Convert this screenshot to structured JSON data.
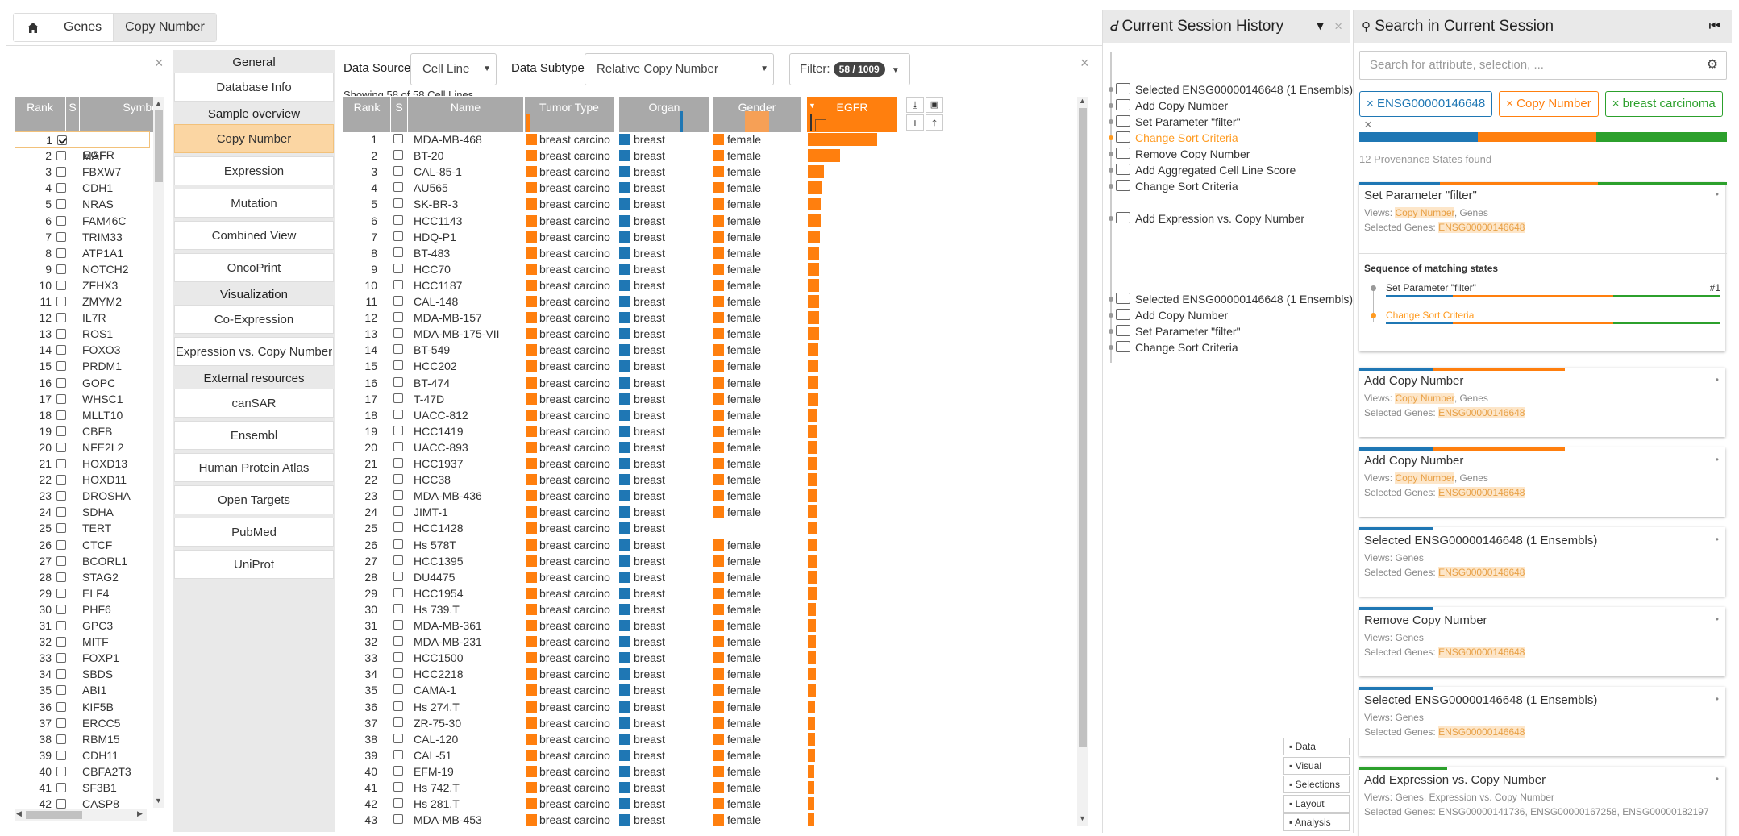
{
  "breadcrumb": {
    "home_icon": "home-icon",
    "items": [
      "Genes",
      "Copy Number"
    ]
  },
  "genes_table": {
    "headers": {
      "rank": "Rank",
      "sel": "S",
      "symbol": "Symbol"
    },
    "rows": [
      {
        "rank": "1",
        "symbol": "EGFR",
        "checked": true
      },
      {
        "rank": "2",
        "symbol": "MAF"
      },
      {
        "rank": "3",
        "symbol": "FBXW7"
      },
      {
        "rank": "4",
        "symbol": "CDH1"
      },
      {
        "rank": "5",
        "symbol": "NRAS"
      },
      {
        "rank": "6",
        "symbol": "FAM46C"
      },
      {
        "rank": "7",
        "symbol": "TRIM33"
      },
      {
        "rank": "8",
        "symbol": "ATP1A1"
      },
      {
        "rank": "9",
        "symbol": "NOTCH2"
      },
      {
        "rank": "10",
        "symbol": "ZFHX3"
      },
      {
        "rank": "11",
        "symbol": "ZMYM2"
      },
      {
        "rank": "12",
        "symbol": "IL7R"
      },
      {
        "rank": "13",
        "symbol": "ROS1"
      },
      {
        "rank": "14",
        "symbol": "FOXO3"
      },
      {
        "rank": "15",
        "symbol": "PRDM1"
      },
      {
        "rank": "16",
        "symbol": "GOPC"
      },
      {
        "rank": "17",
        "symbol": "WHSC1"
      },
      {
        "rank": "18",
        "symbol": "MLLT10"
      },
      {
        "rank": "19",
        "symbol": "CBFB"
      },
      {
        "rank": "20",
        "symbol": "NFE2L2"
      },
      {
        "rank": "21",
        "symbol": "HOXD13"
      },
      {
        "rank": "22",
        "symbol": "HOXD11"
      },
      {
        "rank": "23",
        "symbol": "DROSHA"
      },
      {
        "rank": "24",
        "symbol": "SDHA"
      },
      {
        "rank": "25",
        "symbol": "TERT"
      },
      {
        "rank": "26",
        "symbol": "CTCF"
      },
      {
        "rank": "27",
        "symbol": "BCORL1"
      },
      {
        "rank": "28",
        "symbol": "STAG2"
      },
      {
        "rank": "29",
        "symbol": "ELF4"
      },
      {
        "rank": "30",
        "symbol": "PHF6"
      },
      {
        "rank": "31",
        "symbol": "GPC3"
      },
      {
        "rank": "32",
        "symbol": "MITF"
      },
      {
        "rank": "33",
        "symbol": "FOXP1"
      },
      {
        "rank": "34",
        "symbol": "SBDS"
      },
      {
        "rank": "35",
        "symbol": "ABI1"
      },
      {
        "rank": "36",
        "symbol": "KIF5B"
      },
      {
        "rank": "37",
        "symbol": "ERCC5"
      },
      {
        "rank": "38",
        "symbol": "RBM15"
      },
      {
        "rank": "39",
        "symbol": "CDH11"
      },
      {
        "rank": "40",
        "symbol": "CBFA2T3"
      },
      {
        "rank": "41",
        "symbol": "SF3B1"
      },
      {
        "rank": "42",
        "symbol": "CASP8"
      }
    ]
  },
  "nav": {
    "sections": [
      {
        "title": "General",
        "items": [
          "Database Info"
        ]
      },
      {
        "title": "Sample overview",
        "items": [
          "Copy Number",
          "Expression",
          "Mutation",
          "Combined View",
          "OncoPrint"
        ]
      },
      {
        "title": "Visualization",
        "items": [
          "Co-Expression",
          "Expression vs. Copy Number"
        ]
      },
      {
        "title": "External resources",
        "items": [
          "canSAR",
          "Ensembl",
          "Human Protein Atlas",
          "Open Targets",
          "PubMed",
          "UniProt"
        ]
      }
    ],
    "active": "Copy Number"
  },
  "controls": {
    "data_source_label": "Data Source",
    "data_source_value": "Cell Line",
    "data_subtype_label": "Data Subtype",
    "data_subtype_value": "Relative Copy Number",
    "filter_label": "Filter:",
    "filter_count": "58 / 1009",
    "showing_text": "Showing 58 of 58 Cell Lines"
  },
  "cell_table": {
    "headers": {
      "rank": "Rank",
      "sel": "S",
      "name": "Name",
      "tumor": "Tumor Type",
      "organ": "Organ",
      "gender": "Gender",
      "egfr": "EGFR"
    },
    "colors": {
      "orange": "#ff7f0e",
      "blue": "#1f77b4"
    },
    "rows": [
      {
        "rank": "1",
        "name": "MDA-MB-468",
        "tumor": "breast carcino",
        "organ": "breast",
        "gender": "female",
        "egfr": 0.95
      },
      {
        "rank": "2",
        "name": "BT-20",
        "tumor": "breast carcino",
        "organ": "breast",
        "gender": "female",
        "egfr": 0.44
      },
      {
        "rank": "3",
        "name": "CAL-85-1",
        "tumor": "breast carcino",
        "organ": "breast",
        "gender": "female",
        "egfr": 0.22
      },
      {
        "rank": "4",
        "name": "AU565",
        "tumor": "breast carcino",
        "organ": "breast",
        "gender": "female",
        "egfr": 0.19
      },
      {
        "rank": "5",
        "name": "SK-BR-3",
        "tumor": "breast carcino",
        "organ": "breast",
        "gender": "female",
        "egfr": 0.18
      },
      {
        "rank": "6",
        "name": "HCC1143",
        "tumor": "breast carcino",
        "organ": "breast",
        "gender": "female",
        "egfr": 0.18
      },
      {
        "rank": "7",
        "name": "HDQ-P1",
        "tumor": "breast carcino",
        "organ": "breast",
        "gender": "female",
        "egfr": 0.17
      },
      {
        "rank": "8",
        "name": "BT-483",
        "tumor": "breast carcino",
        "organ": "breast",
        "gender": "female",
        "egfr": 0.16
      },
      {
        "rank": "9",
        "name": "HCC70",
        "tumor": "breast carcino",
        "organ": "breast",
        "gender": "female",
        "egfr": 0.16
      },
      {
        "rank": "10",
        "name": "HCC1187",
        "tumor": "breast carcino",
        "organ": "breast",
        "gender": "female",
        "egfr": 0.16
      },
      {
        "rank": "11",
        "name": "CAL-148",
        "tumor": "breast carcino",
        "organ": "breast",
        "gender": "female",
        "egfr": 0.15
      },
      {
        "rank": "12",
        "name": "MDA-MB-157",
        "tumor": "breast carcino",
        "organ": "breast",
        "gender": "female",
        "egfr": 0.15
      },
      {
        "rank": "13",
        "name": "MDA-MB-175-VII",
        "tumor": "breast carcino",
        "organ": "breast",
        "gender": "female",
        "egfr": 0.15
      },
      {
        "rank": "14",
        "name": "BT-549",
        "tumor": "breast carcino",
        "organ": "breast",
        "gender": "female",
        "egfr": 0.14
      },
      {
        "rank": "15",
        "name": "HCC202",
        "tumor": "breast carcino",
        "organ": "breast",
        "gender": "female",
        "egfr": 0.14
      },
      {
        "rank": "16",
        "name": "BT-474",
        "tumor": "breast carcino",
        "organ": "breast",
        "gender": "female",
        "egfr": 0.14
      },
      {
        "rank": "17",
        "name": "T-47D",
        "tumor": "breast carcino",
        "organ": "breast",
        "gender": "female",
        "egfr": 0.14
      },
      {
        "rank": "18",
        "name": "UACC-812",
        "tumor": "breast carcino",
        "organ": "breast",
        "gender": "female",
        "egfr": 0.13
      },
      {
        "rank": "19",
        "name": "HCC1419",
        "tumor": "breast carcino",
        "organ": "breast",
        "gender": "female",
        "egfr": 0.13
      },
      {
        "rank": "20",
        "name": "UACC-893",
        "tumor": "breast carcino",
        "organ": "breast",
        "gender": "female",
        "egfr": 0.13
      },
      {
        "rank": "21",
        "name": "HCC1937",
        "tumor": "breast carcino",
        "organ": "breast",
        "gender": "female",
        "egfr": 0.13
      },
      {
        "rank": "22",
        "name": "HCC38",
        "tumor": "breast carcino",
        "organ": "breast",
        "gender": "female",
        "egfr": 0.13
      },
      {
        "rank": "23",
        "name": "MDA-MB-436",
        "tumor": "breast carcino",
        "organ": "breast",
        "gender": "female",
        "egfr": 0.13
      },
      {
        "rank": "24",
        "name": "JIMT-1",
        "tumor": "breast carcino",
        "organ": "breast",
        "gender": "female",
        "egfr": 0.12
      },
      {
        "rank": "25",
        "name": "HCC1428",
        "tumor": "breast carcino",
        "organ": "breast",
        "gender": "",
        "egfr": 0.12
      },
      {
        "rank": "26",
        "name": "Hs 578T",
        "tumor": "breast carcino",
        "organ": "breast",
        "gender": "female",
        "egfr": 0.12
      },
      {
        "rank": "27",
        "name": "HCC1395",
        "tumor": "breast carcino",
        "organ": "breast",
        "gender": "female",
        "egfr": 0.12
      },
      {
        "rank": "28",
        "name": "DU4475",
        "tumor": "breast carcino",
        "organ": "breast",
        "gender": "female",
        "egfr": 0.12
      },
      {
        "rank": "29",
        "name": "HCC1954",
        "tumor": "breast carcino",
        "organ": "breast",
        "gender": "female",
        "egfr": 0.12
      },
      {
        "rank": "30",
        "name": "Hs 739.T",
        "tumor": "breast carcino",
        "organ": "breast",
        "gender": "female",
        "egfr": 0.11
      },
      {
        "rank": "31",
        "name": "MDA-MB-361",
        "tumor": "breast carcino",
        "organ": "breast",
        "gender": "female",
        "egfr": 0.11
      },
      {
        "rank": "32",
        "name": "MDA-MB-231",
        "tumor": "breast carcino",
        "organ": "breast",
        "gender": "female",
        "egfr": 0.11
      },
      {
        "rank": "33",
        "name": "HCC1500",
        "tumor": "breast carcino",
        "organ": "breast",
        "gender": "female",
        "egfr": 0.11
      },
      {
        "rank": "34",
        "name": "HCC2218",
        "tumor": "breast carcino",
        "organ": "breast",
        "gender": "female",
        "egfr": 0.11
      },
      {
        "rank": "35",
        "name": "CAMA-1",
        "tumor": "breast carcino",
        "organ": "breast",
        "gender": "female",
        "egfr": 0.11
      },
      {
        "rank": "36",
        "name": "Hs 274.T",
        "tumor": "breast carcino",
        "organ": "breast",
        "gender": "female",
        "egfr": 0.1
      },
      {
        "rank": "37",
        "name": "ZR-75-30",
        "tumor": "breast carcino",
        "organ": "breast",
        "gender": "female",
        "egfr": 0.1
      },
      {
        "rank": "38",
        "name": "CAL-120",
        "tumor": "breast carcino",
        "organ": "breast",
        "gender": "female",
        "egfr": 0.1
      },
      {
        "rank": "39",
        "name": "CAL-51",
        "tumor": "breast carcino",
        "organ": "breast",
        "gender": "female",
        "egfr": 0.1
      },
      {
        "rank": "40",
        "name": "EFM-19",
        "tumor": "breast carcino",
        "organ": "breast",
        "gender": "female",
        "egfr": 0.09
      },
      {
        "rank": "41",
        "name": "Hs 742.T",
        "tumor": "breast carcino",
        "organ": "breast",
        "gender": "female",
        "egfr": 0.09
      },
      {
        "rank": "42",
        "name": "Hs 281.T",
        "tumor": "breast carcino",
        "organ": "breast",
        "gender": "female",
        "egfr": 0.09
      },
      {
        "rank": "43",
        "name": "MDA-MB-453",
        "tumor": "breast carcino",
        "organ": "breast",
        "gender": "female",
        "egfr": 0.09
      }
    ]
  },
  "history": {
    "title": "Current Session History",
    "items": [
      {
        "text": "Selected ENSG00000146648 (1 Ensembls)",
        "icon": "selection-icon"
      },
      {
        "text": "Add Copy Number",
        "icon": "chart-add-icon"
      },
      {
        "text": "Set Parameter \"filter\"",
        "icon": "chart-param-icon"
      },
      {
        "text": "Change Sort Criteria",
        "icon": "monitor-icon",
        "active": true
      },
      {
        "text": "Remove Copy Number",
        "icon": "chart-remove-icon"
      },
      {
        "text": "Add Aggregated Cell Line Score",
        "icon": "db-add-icon"
      },
      {
        "text": "Change Sort Criteria",
        "icon": "monitor-icon"
      },
      {
        "text": "",
        "icon": ""
      },
      {
        "text": "Add Expression vs. Copy Number",
        "icon": "chart-add-icon"
      },
      {
        "text": "",
        "icon": ""
      },
      {
        "text": "",
        "icon": ""
      },
      {
        "text": "",
        "icon": ""
      },
      {
        "text": "",
        "icon": ""
      },
      {
        "text": "Selected ENSG00000146648 (1 Ensembls)",
        "icon": "selection-icon"
      },
      {
        "text": "Add Copy Number",
        "icon": "chart-add-icon"
      },
      {
        "text": "Set Parameter \"filter\"",
        "icon": "chart-param-icon"
      },
      {
        "text": "Change Sort Criteria",
        "icon": "monitor-icon"
      }
    ],
    "side_buttons": [
      "Data",
      "Visual",
      "Selections",
      "Layout",
      "Analysis"
    ]
  },
  "search": {
    "title": "Search in Current Session",
    "placeholder": "Search for attribute, selection, ...",
    "tags": [
      {
        "label": "ENSG00000146648",
        "color": "#1f77b4"
      },
      {
        "label": "Copy Number",
        "color": "#ff7f0e"
      },
      {
        "label": "breast carcinoma",
        "color": "#2ca02c"
      }
    ],
    "found_text": "12 Provenance States found",
    "views_label": "Views:",
    "genes_label": "Selected Genes:",
    "cards": [
      {
        "title": "Set Parameter \"filter\"",
        "views_hl": "Copy Number",
        "views_rest": ", Genes",
        "genes": "ENSG00000146648",
        "expanded": true,
        "seq_title": "Sequence of matching states",
        "seq_items": [
          {
            "label": "Set Parameter \"filter\"",
            "num": "#1"
          },
          {
            "label": "Change Sort Criteria"
          }
        ]
      },
      {
        "title": "Add Copy Number",
        "views_hl": "Copy Number",
        "views_rest": ", Genes",
        "genes": "ENSG00000146648"
      },
      {
        "title": "Add Copy Number",
        "views_hl": "Copy Number",
        "views_rest": ", Genes",
        "genes": "ENSG00000146648"
      },
      {
        "title": "Selected ENSG00000146648 (1 Ensembls)",
        "views_hl": "",
        "views_rest": "Genes",
        "genes": "ENSG00000146648"
      },
      {
        "title": "Remove Copy Number",
        "views_hl": "",
        "views_rest": "Genes",
        "genes": "ENSG00000146648"
      },
      {
        "title": "Selected ENSG00000146648 (1 Ensembls)",
        "views_hl": "",
        "views_rest": "Genes",
        "genes": "ENSG00000146648"
      },
      {
        "title": "Add Expression vs. Copy Number",
        "views_hl": "",
        "views_rest": "Genes, Expression vs. Copy Number",
        "genes_plain": "ENSG00000141736, ENSG00000167258, ENSG00000182197"
      }
    ]
  }
}
